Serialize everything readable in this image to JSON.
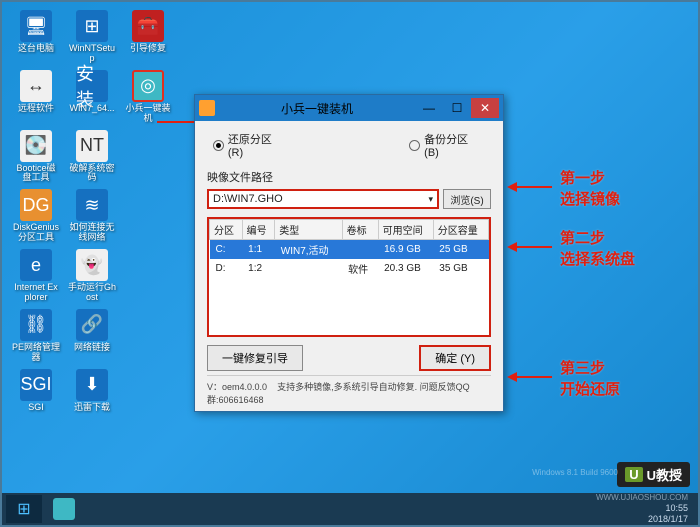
{
  "desktop": {
    "rows": [
      [
        {
          "label": "这台电脑",
          "name": "this-pc",
          "cls": "bg-blue",
          "glyph": "🖥"
        },
        {
          "label": "WinNTSetup",
          "name": "winntsetup",
          "cls": "bg-blue",
          "glyph": "⊞"
        },
        {
          "label": "引导修复",
          "name": "boot-repair",
          "cls": "bg-red",
          "glyph": "🧰"
        }
      ],
      [
        {
          "label": "远程软件",
          "name": "remote-soft",
          "cls": "bg-white",
          "glyph": "↔"
        },
        {
          "label": "WIN7_64...",
          "name": "win7-64",
          "cls": "bg-blue",
          "glyph": "安装"
        },
        {
          "label": "小兵一键装机",
          "name": "xiaobing-installer",
          "cls": "bg-cyan highlighted-icon",
          "glyph": "◎"
        }
      ],
      [
        {
          "label": "Bootice磁盘工具",
          "name": "bootice",
          "cls": "bg-white",
          "glyph": "💽"
        },
        {
          "label": "破解系统密码",
          "name": "crack-pwd",
          "cls": "bg-white",
          "glyph": "NT"
        }
      ],
      [
        {
          "label": "DiskGenius分区工具",
          "name": "diskgenius",
          "cls": "bg-orange",
          "glyph": "DG"
        },
        {
          "label": "如何连接无线网络",
          "name": "wifi-help",
          "cls": "bg-blue",
          "glyph": "≋"
        }
      ],
      [
        {
          "label": "Internet Explorer",
          "name": "ie",
          "cls": "bg-blue",
          "glyph": "e"
        },
        {
          "label": "手动运行Ghost",
          "name": "ghost",
          "cls": "bg-white",
          "glyph": "👻"
        }
      ],
      [
        {
          "label": "PE网络管理器",
          "name": "pe-net",
          "cls": "bg-blue",
          "glyph": "⛓"
        },
        {
          "label": "网络链接",
          "name": "net-conn",
          "cls": "bg-blue",
          "glyph": "🔗"
        }
      ],
      [
        {
          "label": "SGI",
          "name": "sgi",
          "cls": "bg-blue",
          "glyph": "SGI"
        },
        {
          "label": "迅雷下载",
          "name": "thunder",
          "cls": "bg-blue",
          "glyph": "⬇"
        }
      ]
    ]
  },
  "dialog": {
    "title": "小兵一键装机",
    "radio_restore": "还原分区 (R)",
    "radio_backup": "备份分区 (B)",
    "image_label": "映像文件路径",
    "path_value": "D:\\WIN7.GHO",
    "browse": "浏览(S)",
    "columns": [
      "分区",
      "编号",
      "类型",
      "卷标",
      "可用空间",
      "分区容量"
    ],
    "rows": [
      {
        "p": "C:",
        "n": "1:1",
        "t": "WIN7,活动",
        "v": "",
        "free": "16.9 GB",
        "cap": "25 GB",
        "sel": true
      },
      {
        "p": "D:",
        "n": "1:2",
        "t": "",
        "v": "软件",
        "free": "20.3 GB",
        "cap": "35 GB",
        "sel": false
      }
    ],
    "repair_btn": "一键修复引导",
    "ok_btn": "确定 (Y)",
    "version": "V：oem4.0.0.0",
    "footer": "支持多种镜像,多系统引导自动修复. 问题反馈QQ群:606616468"
  },
  "annotations": {
    "step1_title": "第一步",
    "step1_text": "选择镜像",
    "step2_title": "第二步",
    "step2_text": "选择系统盘",
    "step3_title": "第三步",
    "step3_text": "开始还原"
  },
  "taskbar": {
    "time": "10:55",
    "date": "2018/1/17",
    "build": "Windows 8.1 Build 9600"
  },
  "watermark": {
    "brand": "U教授",
    "url": "WWW.UJIAOSHOU.COM"
  }
}
